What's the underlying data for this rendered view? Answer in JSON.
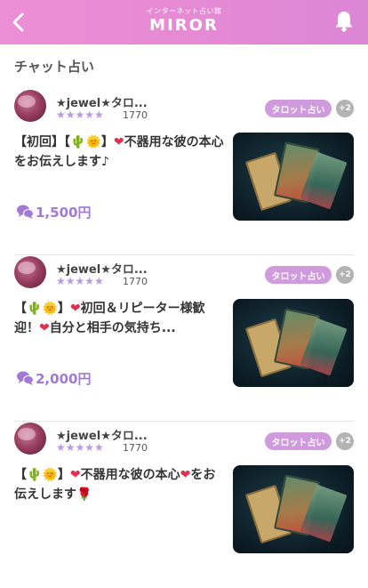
{
  "header": {
    "logo_sub": "インターネット占い館",
    "logo_main": "MIROR"
  },
  "section_title": "チャット占い",
  "cards": [
    {
      "name": "★jewel★タロ...",
      "stars": "★★★★★",
      "rating_count": "1770",
      "tag": "タロット占い",
      "more_tags": "+2",
      "desc_parts": [
        "【初回】【",
        "🌵",
        "🌞",
        "】",
        "❤",
        "不器用な彼の本心をお伝えします♪"
      ],
      "price": "1,500円"
    },
    {
      "name": "★jewel★タロ...",
      "stars": "★★★★★",
      "rating_count": "1770",
      "tag": "タロット占い",
      "more_tags": "+2",
      "desc_parts": [
        "【",
        "🌵",
        "🌞",
        "】",
        "❤",
        "初回＆リピーター様歓迎！",
        "❤",
        "自分と相手の気持ち..."
      ],
      "price": "2,000円"
    },
    {
      "name": "★jewel★タロ...",
      "stars": "★★★★★",
      "rating_count": "1770",
      "tag": "タロット占い",
      "more_tags": "+2",
      "desc_parts": [
        "【",
        "🌵",
        "🌞",
        "】",
        "❤",
        "不器用な彼の本心",
        "❤",
        "をお伝えします",
        "🌹"
      ],
      "price": ""
    }
  ],
  "colors": {
    "header_gradient_start": "#ec8fd6",
    "header_gradient_end": "#dc86d6",
    "tag_bg": "#cf9bdc",
    "price": "#a07ad6",
    "stars": "#b79ae0"
  },
  "icons": {
    "back": "chevron-left-icon",
    "bell": "bell-icon",
    "chat": "chat-bubbles-icon"
  }
}
